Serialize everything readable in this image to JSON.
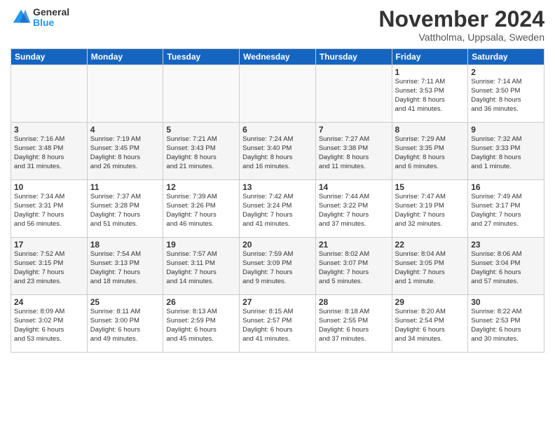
{
  "logo": {
    "general": "General",
    "blue": "Blue"
  },
  "title": "November 2024",
  "location": "Vattholma, Uppsala, Sweden",
  "weekdays": [
    "Sunday",
    "Monday",
    "Tuesday",
    "Wednesday",
    "Thursday",
    "Friday",
    "Saturday"
  ],
  "weeks": [
    [
      {
        "day": "",
        "info": ""
      },
      {
        "day": "",
        "info": ""
      },
      {
        "day": "",
        "info": ""
      },
      {
        "day": "",
        "info": ""
      },
      {
        "day": "",
        "info": ""
      },
      {
        "day": "1",
        "info": "Sunrise: 7:11 AM\nSunset: 3:53 PM\nDaylight: 8 hours\nand 41 minutes."
      },
      {
        "day": "2",
        "info": "Sunrise: 7:14 AM\nSunset: 3:50 PM\nDaylight: 8 hours\nand 36 minutes."
      }
    ],
    [
      {
        "day": "3",
        "info": "Sunrise: 7:16 AM\nSunset: 3:48 PM\nDaylight: 8 hours\nand 31 minutes."
      },
      {
        "day": "4",
        "info": "Sunrise: 7:19 AM\nSunset: 3:45 PM\nDaylight: 8 hours\nand 26 minutes."
      },
      {
        "day": "5",
        "info": "Sunrise: 7:21 AM\nSunset: 3:43 PM\nDaylight: 8 hours\nand 21 minutes."
      },
      {
        "day": "6",
        "info": "Sunrise: 7:24 AM\nSunset: 3:40 PM\nDaylight: 8 hours\nand 16 minutes."
      },
      {
        "day": "7",
        "info": "Sunrise: 7:27 AM\nSunset: 3:38 PM\nDaylight: 8 hours\nand 11 minutes."
      },
      {
        "day": "8",
        "info": "Sunrise: 7:29 AM\nSunset: 3:35 PM\nDaylight: 8 hours\nand 6 minutes."
      },
      {
        "day": "9",
        "info": "Sunrise: 7:32 AM\nSunset: 3:33 PM\nDaylight: 8 hours\nand 1 minute."
      }
    ],
    [
      {
        "day": "10",
        "info": "Sunrise: 7:34 AM\nSunset: 3:31 PM\nDaylight: 7 hours\nand 56 minutes."
      },
      {
        "day": "11",
        "info": "Sunrise: 7:37 AM\nSunset: 3:28 PM\nDaylight: 7 hours\nand 51 minutes."
      },
      {
        "day": "12",
        "info": "Sunrise: 7:39 AM\nSunset: 3:26 PM\nDaylight: 7 hours\nand 46 minutes."
      },
      {
        "day": "13",
        "info": "Sunrise: 7:42 AM\nSunset: 3:24 PM\nDaylight: 7 hours\nand 41 minutes."
      },
      {
        "day": "14",
        "info": "Sunrise: 7:44 AM\nSunset: 3:22 PM\nDaylight: 7 hours\nand 37 minutes."
      },
      {
        "day": "15",
        "info": "Sunrise: 7:47 AM\nSunset: 3:19 PM\nDaylight: 7 hours\nand 32 minutes."
      },
      {
        "day": "16",
        "info": "Sunrise: 7:49 AM\nSunset: 3:17 PM\nDaylight: 7 hours\nand 27 minutes."
      }
    ],
    [
      {
        "day": "17",
        "info": "Sunrise: 7:52 AM\nSunset: 3:15 PM\nDaylight: 7 hours\nand 23 minutes."
      },
      {
        "day": "18",
        "info": "Sunrise: 7:54 AM\nSunset: 3:13 PM\nDaylight: 7 hours\nand 18 minutes."
      },
      {
        "day": "19",
        "info": "Sunrise: 7:57 AM\nSunset: 3:11 PM\nDaylight: 7 hours\nand 14 minutes."
      },
      {
        "day": "20",
        "info": "Sunrise: 7:59 AM\nSunset: 3:09 PM\nDaylight: 7 hours\nand 9 minutes."
      },
      {
        "day": "21",
        "info": "Sunrise: 8:02 AM\nSunset: 3:07 PM\nDaylight: 7 hours\nand 5 minutes."
      },
      {
        "day": "22",
        "info": "Sunrise: 8:04 AM\nSunset: 3:05 PM\nDaylight: 7 hours\nand 1 minute."
      },
      {
        "day": "23",
        "info": "Sunrise: 8:06 AM\nSunset: 3:04 PM\nDaylight: 6 hours\nand 57 minutes."
      }
    ],
    [
      {
        "day": "24",
        "info": "Sunrise: 8:09 AM\nSunset: 3:02 PM\nDaylight: 6 hours\nand 53 minutes."
      },
      {
        "day": "25",
        "info": "Sunrise: 8:11 AM\nSunset: 3:00 PM\nDaylight: 6 hours\nand 49 minutes."
      },
      {
        "day": "26",
        "info": "Sunrise: 8:13 AM\nSunset: 2:59 PM\nDaylight: 6 hours\nand 45 minutes."
      },
      {
        "day": "27",
        "info": "Sunrise: 8:15 AM\nSunset: 2:57 PM\nDaylight: 6 hours\nand 41 minutes."
      },
      {
        "day": "28",
        "info": "Sunrise: 8:18 AM\nSunset: 2:55 PM\nDaylight: 6 hours\nand 37 minutes."
      },
      {
        "day": "29",
        "info": "Sunrise: 8:20 AM\nSunset: 2:54 PM\nDaylight: 6 hours\nand 34 minutes."
      },
      {
        "day": "30",
        "info": "Sunrise: 8:22 AM\nSunset: 2:53 PM\nDaylight: 6 hours\nand 30 minutes."
      }
    ]
  ]
}
